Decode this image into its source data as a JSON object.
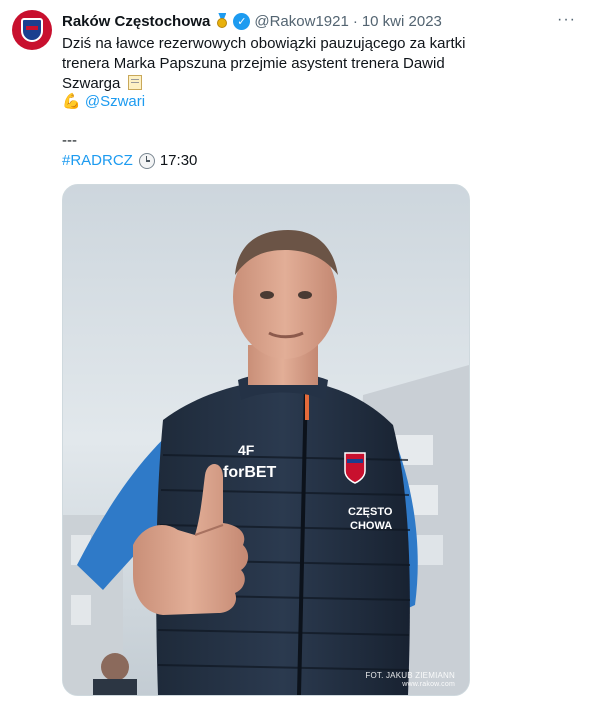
{
  "tweet": {
    "author_name": "Raków Częstochowa",
    "handle": "@Rakow1921",
    "separator": "·",
    "date": "10 kwi 2023",
    "more_label": "···",
    "text": "Dziś na ławce rezerwowych obowiązki pauzującego za kartki trenera Marka Papszuna przejmie asystent trenera Dawid Szwarga",
    "mention": "@Szwari",
    "dashes": "---",
    "hashtag": "#RADRCZ",
    "time": "17:30",
    "icons": {
      "medal": "medal-icon",
      "verified": "verified-badge-icon",
      "memo": "memo-icon",
      "muscle": "flexed-biceps-icon",
      "clock": "clock-icon"
    }
  },
  "photo": {
    "credit_line1": "FOT. JAKUB ZIEMIANN",
    "credit_line2": "www.rakow.com"
  },
  "colors": {
    "link": "#1d9bf0",
    "muted": "#536471",
    "club_red": "#c8102e",
    "club_blue": "#1b3f8f"
  }
}
